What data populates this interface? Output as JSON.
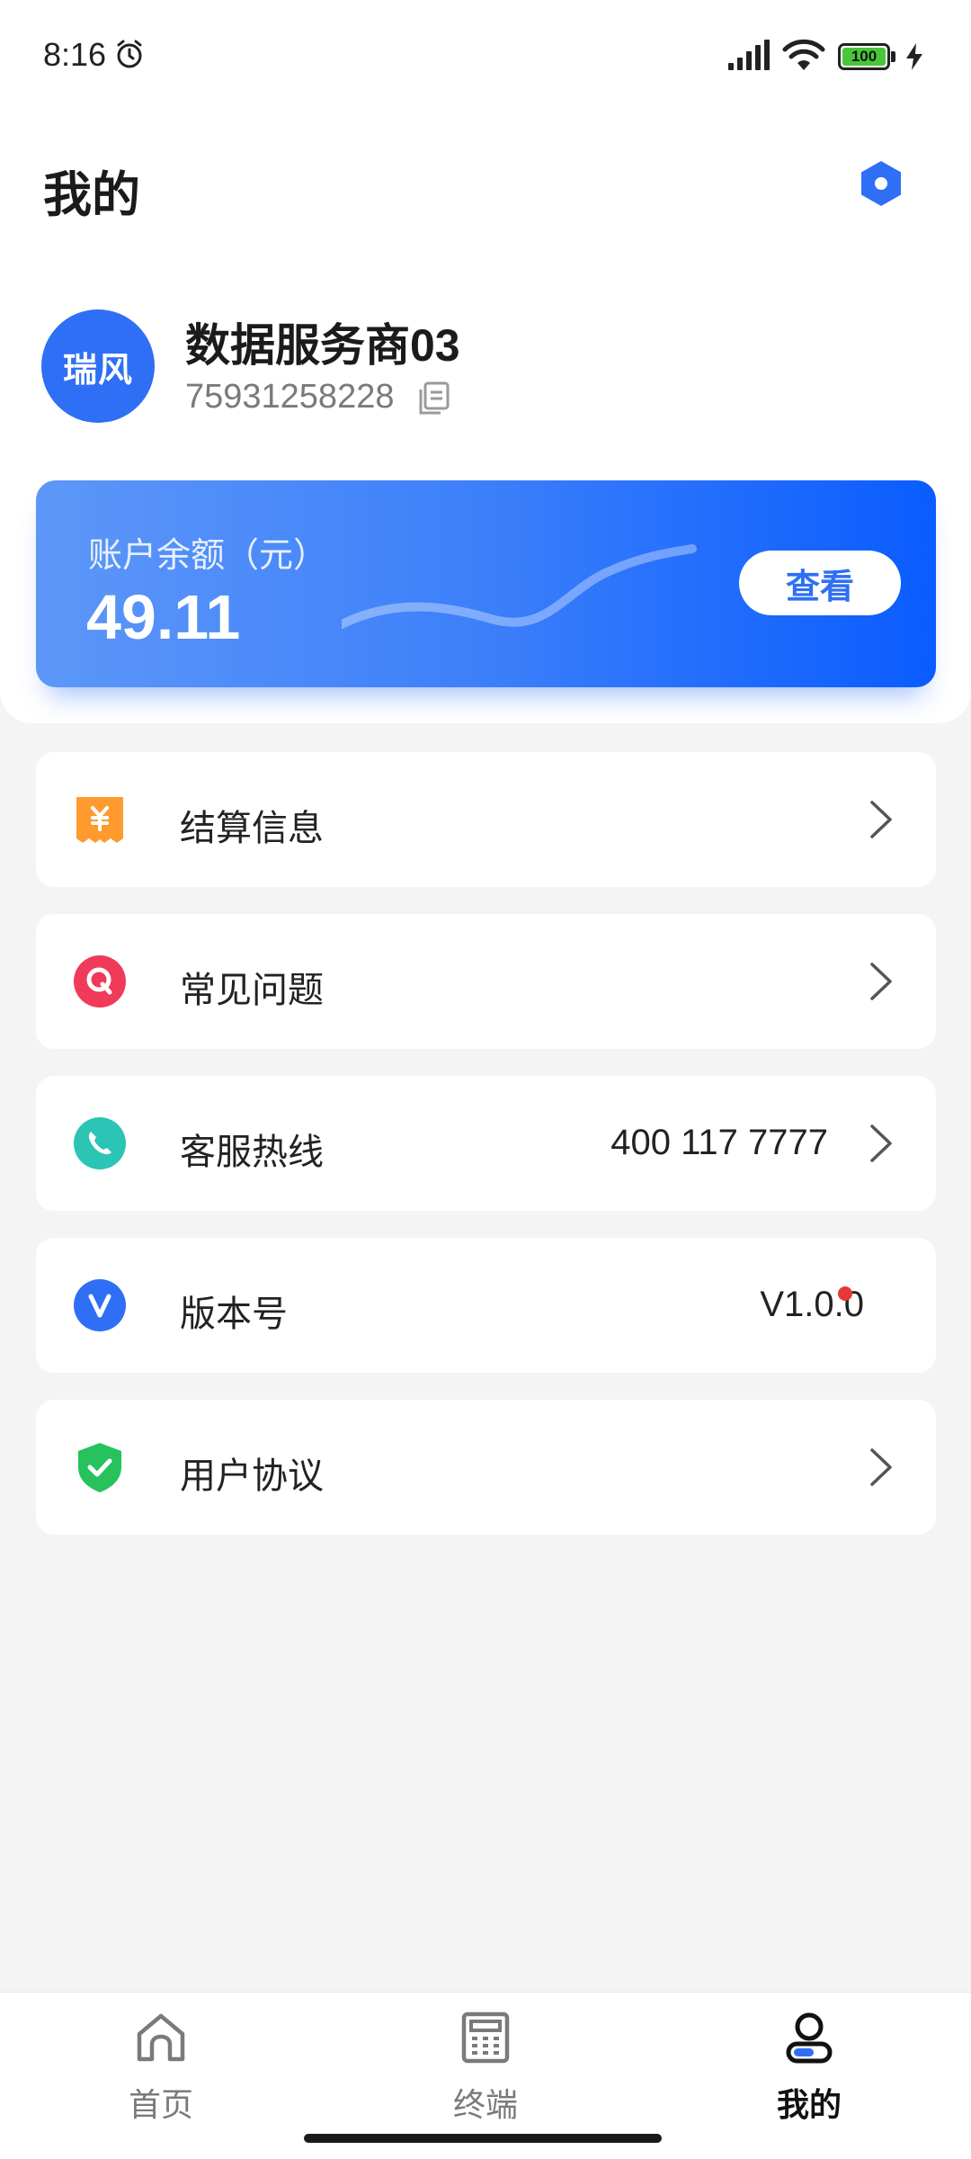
{
  "status_bar": {
    "time": "8:16",
    "battery": "100",
    "icons": [
      "alarm-icon",
      "signal-icon",
      "wifi-icon",
      "battery-icon",
      "charging-icon"
    ]
  },
  "header": {
    "title": "我的",
    "settings_icon": "settings-hexagon-icon"
  },
  "profile": {
    "avatar_text": "瑞风",
    "name": "数据服务商03",
    "id": "75931258228",
    "copy_icon": "copy-icon"
  },
  "balance_card": {
    "label": "账户余额（元）",
    "value": "49.11",
    "button_label": "查看"
  },
  "menu": [
    {
      "label": "结算信息",
      "value": "",
      "icon": "settlement-receipt-icon",
      "chevron": true
    },
    {
      "label": "常见问题",
      "value": "",
      "icon": "faq-q-icon",
      "chevron": true
    },
    {
      "label": "客服热线",
      "value": "400 117 7777",
      "icon": "phone-icon",
      "chevron": true
    },
    {
      "label": "版本号",
      "value": "V1.0.0",
      "icon": "version-v-icon",
      "chevron": false,
      "badge": true
    },
    {
      "label": "用户协议",
      "value": "",
      "icon": "shield-check-icon",
      "chevron": true
    }
  ],
  "bottom_nav": {
    "items": [
      {
        "label": "首页",
        "icon": "home-icon",
        "active": false
      },
      {
        "label": "终端",
        "icon": "terminal-calculator-icon",
        "active": false
      },
      {
        "label": "我的",
        "icon": "profile-icon",
        "active": true
      }
    ]
  },
  "colors": {
    "accent": "#2f6ff5",
    "background": "#f4f4f5",
    "settlement_icon": "#ff9a2e",
    "faq_icon": "#f03a5a",
    "phone_icon": "#2cc4b4",
    "version_icon": "#2f6ff5",
    "agreement_icon": "#27c25c",
    "badge": "#e53935"
  }
}
